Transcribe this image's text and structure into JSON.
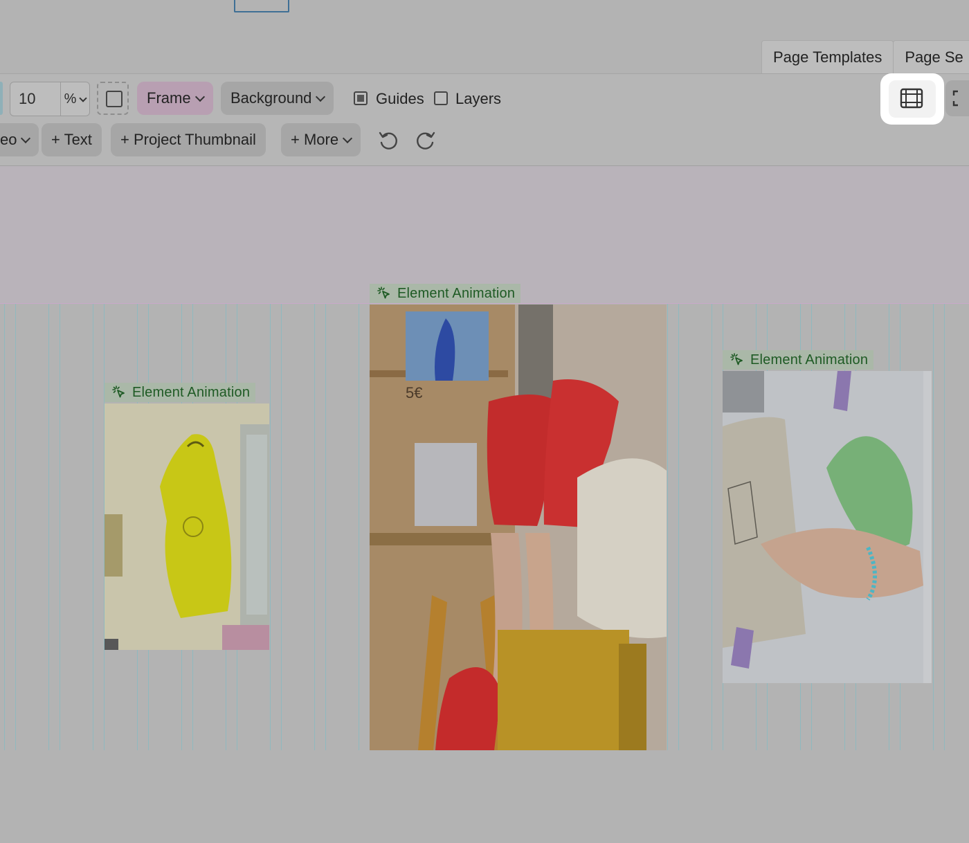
{
  "page_tabs": {
    "templates_label": "Page Templates",
    "settings_label": "Page Se"
  },
  "toolbar": {
    "grid_value": "10",
    "grid_unit": "%",
    "frame_label": "Frame",
    "background_label": "Background",
    "guides_label": "Guides",
    "guides_checked": true,
    "layers_label": "Layers",
    "layers_checked": false,
    "video_label": "eo",
    "add_text_label": "+ Text",
    "add_thumbnail_label": "+ Project Thumbnail",
    "more_label": "+ More"
  },
  "canvas": {
    "animation_tag_label": "Element Animation",
    "images": [
      {
        "name": "yellow-raincoat-photo"
      },
      {
        "name": "red-boots-photo"
      },
      {
        "name": "hand-drawing-photo"
      }
    ]
  },
  "icons": [
    "film-strip-icon",
    "fullscreen-icon",
    "undo-icon",
    "redo-icon",
    "sparkle-cursor-icon"
  ]
}
